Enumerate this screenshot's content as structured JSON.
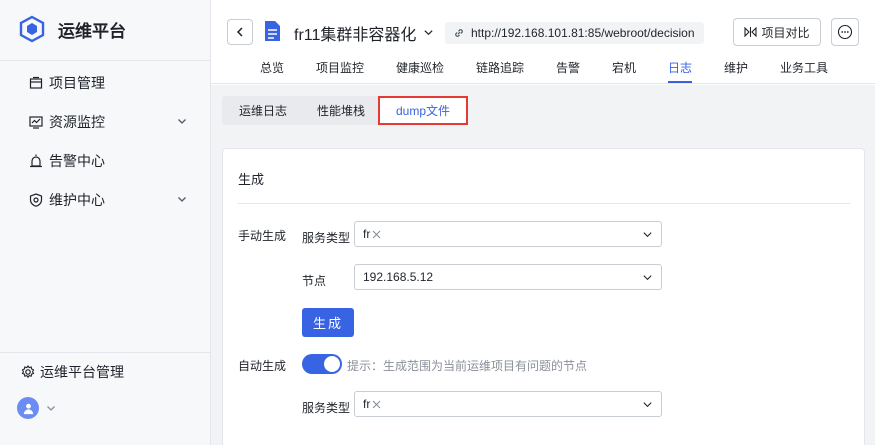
{
  "brand": {
    "name": "运维平台"
  },
  "sidebar": {
    "items": [
      {
        "label": "项目管理",
        "icon": "project-icon"
      },
      {
        "label": "资源监控",
        "icon": "monitor-icon"
      },
      {
        "label": "告警中心",
        "icon": "alarm-icon"
      },
      {
        "label": "维护中心",
        "icon": "maintenance-icon"
      }
    ],
    "bottom_label": "运维平台管理"
  },
  "header": {
    "project_name": "fr11集群非容器化",
    "url": "http://192.168.101.81:85/webroot/decision",
    "compare_label": "项目对比",
    "tabs": [
      "总览",
      "项目监控",
      "健康巡检",
      "链路追踪",
      "告警",
      "宕机",
      "日志",
      "维护",
      "业务工具"
    ],
    "active_tab": "日志"
  },
  "subtabs": [
    "运维日志",
    "性能堆栈",
    "dump文件"
  ],
  "card": {
    "title": "生成",
    "manual_label": "手动生成",
    "service_type_label": "服务类型",
    "service_tag": "fr",
    "node_label": "节点",
    "node_value": "192.168.5.12",
    "generate_button": "生成",
    "auto_label": "自动生成",
    "auto_enabled": true,
    "tip": "提示：生成范围为当前运维项目有问题的节点",
    "auto_service_type_label": "服务类型",
    "auto_service_tag": "fr"
  },
  "colors": {
    "accent": "#3863e3",
    "highlight_border": "#e53935"
  }
}
